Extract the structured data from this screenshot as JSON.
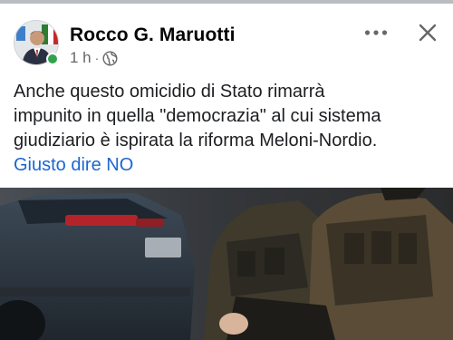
{
  "post": {
    "author": "Rocco G. Maruotti",
    "time": "1 h",
    "separator": "·",
    "audience_icon": "globe-icon",
    "text_lines": [
      "Anche questo omicidio di Stato rimarrà",
      "impunito in quella \"democrazia\" al cui sistema",
      "giudiziario è ispirata la riforma Meloni-Nordio."
    ],
    "link": "Giusto dire NO",
    "link_color": "#1b66d2",
    "online_status_color": "#31a24c"
  },
  "header_actions": {
    "more_icon": "more-horizontal-icon",
    "close_icon": "close-icon"
  }
}
